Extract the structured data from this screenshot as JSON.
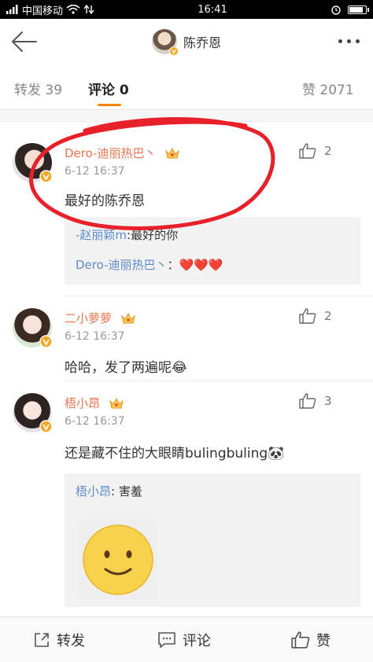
{
  "status_bar": {
    "carrier": "中国移动",
    "time": "16:41",
    "battery_level": 0.9
  },
  "header": {
    "title": "陈乔恩"
  },
  "tabs": [
    {
      "label": "转发 39"
    },
    {
      "label": "评论 0"
    },
    {
      "label": "赞 2071"
    }
  ],
  "comments": [
    {
      "username": "Dero-迪丽热巴丶",
      "timestamp": "6-12 16:37",
      "text": "最好的陈乔恩",
      "likes": "2",
      "replies": [
        {
          "name": "-赵丽颖m",
          "text": ":最好的你"
        },
        {
          "name": "Dero-迪丽热巴丶",
          "text": "：❤️❤️❤️"
        }
      ]
    },
    {
      "username": "二小萝萝",
      "timestamp": "6-12 16:37",
      "text": "哈哈，发了两遍呢😂",
      "likes": "2"
    },
    {
      "username": "梧小昂",
      "timestamp": "6-12 16:37",
      "text": "还是藏不住的大眼睛bulingbuling🐼",
      "likes": "3",
      "replies": [
        {
          "name": "梧小昂",
          "text": ": 害羞"
        }
      ]
    }
  ],
  "bottom_bar": {
    "repost": "转发",
    "comment": "评论",
    "like": "赞"
  },
  "colors": {
    "accent": "#ff8200",
    "username": "#eb7350",
    "link": "#5d8ccd",
    "annotation": "#e8202a"
  },
  "icons": [
    "back-arrow-icon",
    "more-dots-icon",
    "thumbs-up-icon",
    "verified-v-icon",
    "crown-icon",
    "share-icon",
    "comment-icon",
    "smiley-sticker-icon"
  ]
}
